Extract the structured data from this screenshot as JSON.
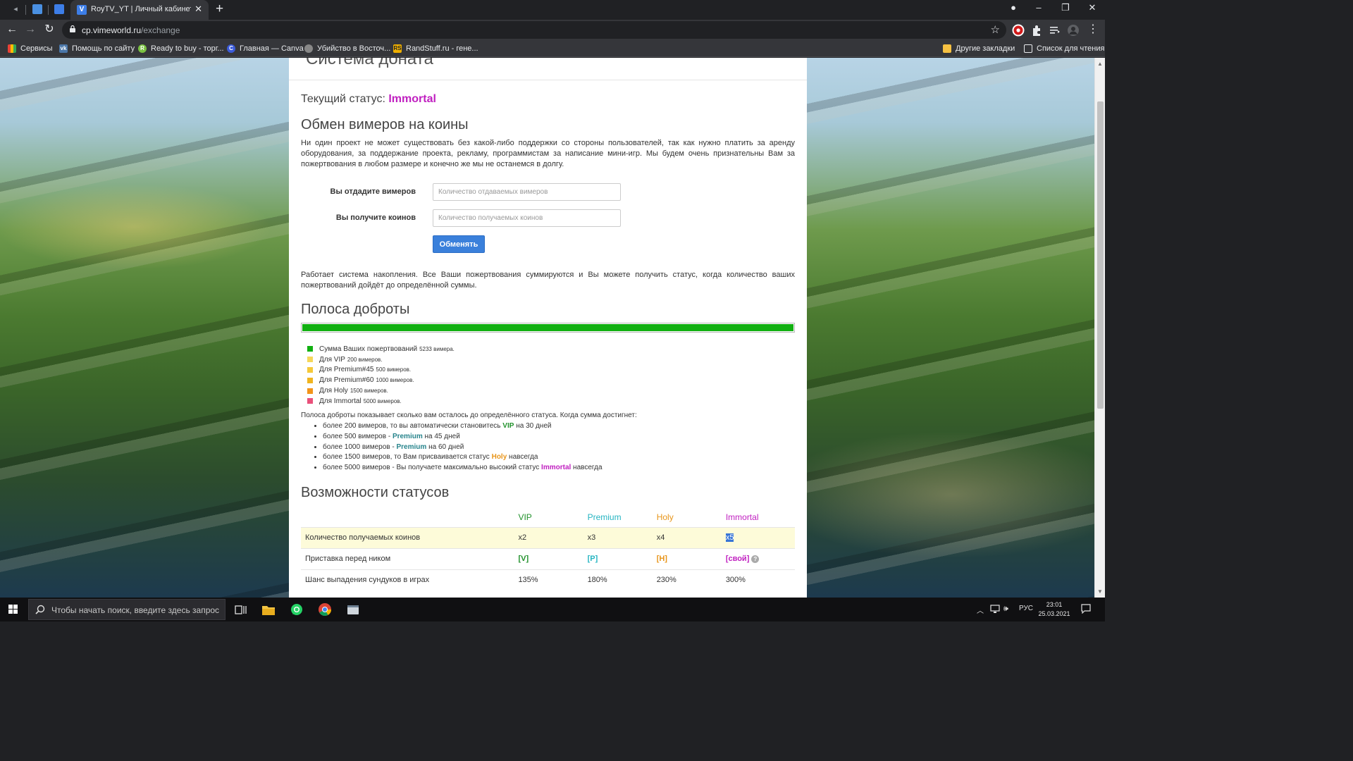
{
  "browser": {
    "tab_title": "RoyTV_YT | Личный кабинет Vi",
    "url_domain": "cp.vimeworld.ru",
    "url_path": "/exchange",
    "bookmarks": [
      "Сервисы",
      "Помощь по сайту",
      "Ready to buy - торг...",
      "Главная — Canva",
      "Убийство в Восточ...",
      "RandStuff.ru - гене..."
    ],
    "bookmarks_other": "Другие закладки",
    "reading_list": "Список для чтения"
  },
  "page": {
    "header_title": "Система доната",
    "status_label": "Текущий статус:",
    "status_value": "Immortal",
    "exchange_title": "Обмен вимеров на коины",
    "intro_text": "Ни один проект не может существовать без какой-либо поддержки со стороны пользователей, так как нужно платить за аренду оборудования, за поддержание проекта, рекламу, программистам за написание мини-игр. Мы будем очень признательны Вам за пожертвования в любом размере и конечно же мы не останемся в долгу.",
    "give_label": "Вы отдадите вимеров",
    "give_placeholder": "Количество отдаваемых вимеров",
    "get_label": "Вы получите коинов",
    "get_placeholder": "Количество получаемых коинов",
    "exchange_button": "Обменять",
    "accumulation_text": "Работает система накопления. Все Ваши пожертвования суммируются и Вы можете получить статус, когда количество ваших пожертвований дойдёт до определённой суммы.",
    "kindness_title": "Полоса доброты",
    "kindness_progress": 1.0,
    "legend": [
      {
        "label": "Сумма Ваших пожертвований",
        "amount": "5233 вимера.",
        "color": "#11b011"
      },
      {
        "label": "Для VIP",
        "amount": "200 вимеров.",
        "color": "#f5d75a"
      },
      {
        "label": "Для Premium#45",
        "amount": "500 вимеров.",
        "color": "#f5c93a"
      },
      {
        "label": "Для Premium#60",
        "amount": "1000 вимеров.",
        "color": "#f0b41f"
      },
      {
        "label": "Для Holy",
        "amount": "1500 вимеров.",
        "color": "#f29419"
      },
      {
        "label": "Для Immortal",
        "amount": "5000 вимеров.",
        "color": "#e9507a"
      }
    ],
    "tiers_intro": "Полоса доброты показывает сколько вам осталось до определённого статуса. Когда сумма достигнет:",
    "tiers": [
      {
        "pre": "более 200 вимеров, то вы автоматически становитесь ",
        "hl": "VIP",
        "post": " на 30 дней"
      },
      {
        "pre": "более 500 вимеров - ",
        "hl": "Premium",
        "post": " на 45 дней"
      },
      {
        "pre": "более 1000 вимеров - ",
        "hl": "Premium",
        "post": " на 60 дней"
      },
      {
        "pre": "более 1500 вимеров, то Вам присваивается статус ",
        "hl": "Holy",
        "post": " навсегда"
      },
      {
        "pre": "более 5000 вимеров - Вы получаете максимально высокий статус ",
        "hl": "Immortal",
        "post": " навсегда"
      }
    ],
    "features_title": "Возможности статусов",
    "features_headers": [
      "VIP",
      "Premium",
      "Holy",
      "Immortal"
    ],
    "features_rows": [
      {
        "label": "Количество получаемых коинов",
        "values": [
          "x2",
          "x3",
          "x4",
          "x5"
        ]
      },
      {
        "label": "Приставка перед ником",
        "values": [
          "[V]",
          "[P]",
          "[H]",
          "[свой]"
        ]
      },
      {
        "label": "Шанс выпадения сундуков в играх",
        "values": [
          "135%",
          "180%",
          "230%",
          "300%"
        ]
      }
    ]
  },
  "taskbar": {
    "search_placeholder": "Чтобы начать поиск, введите здесь запрос",
    "language": "РУС",
    "time": "23:01",
    "date": "25.03.2021"
  },
  "colors": {
    "vip": "#21912b",
    "premium": "#27848c",
    "holy": "#e8951a",
    "immortal": "#c020c0",
    "button": "#3a80db",
    "progress": "#11b011"
  }
}
